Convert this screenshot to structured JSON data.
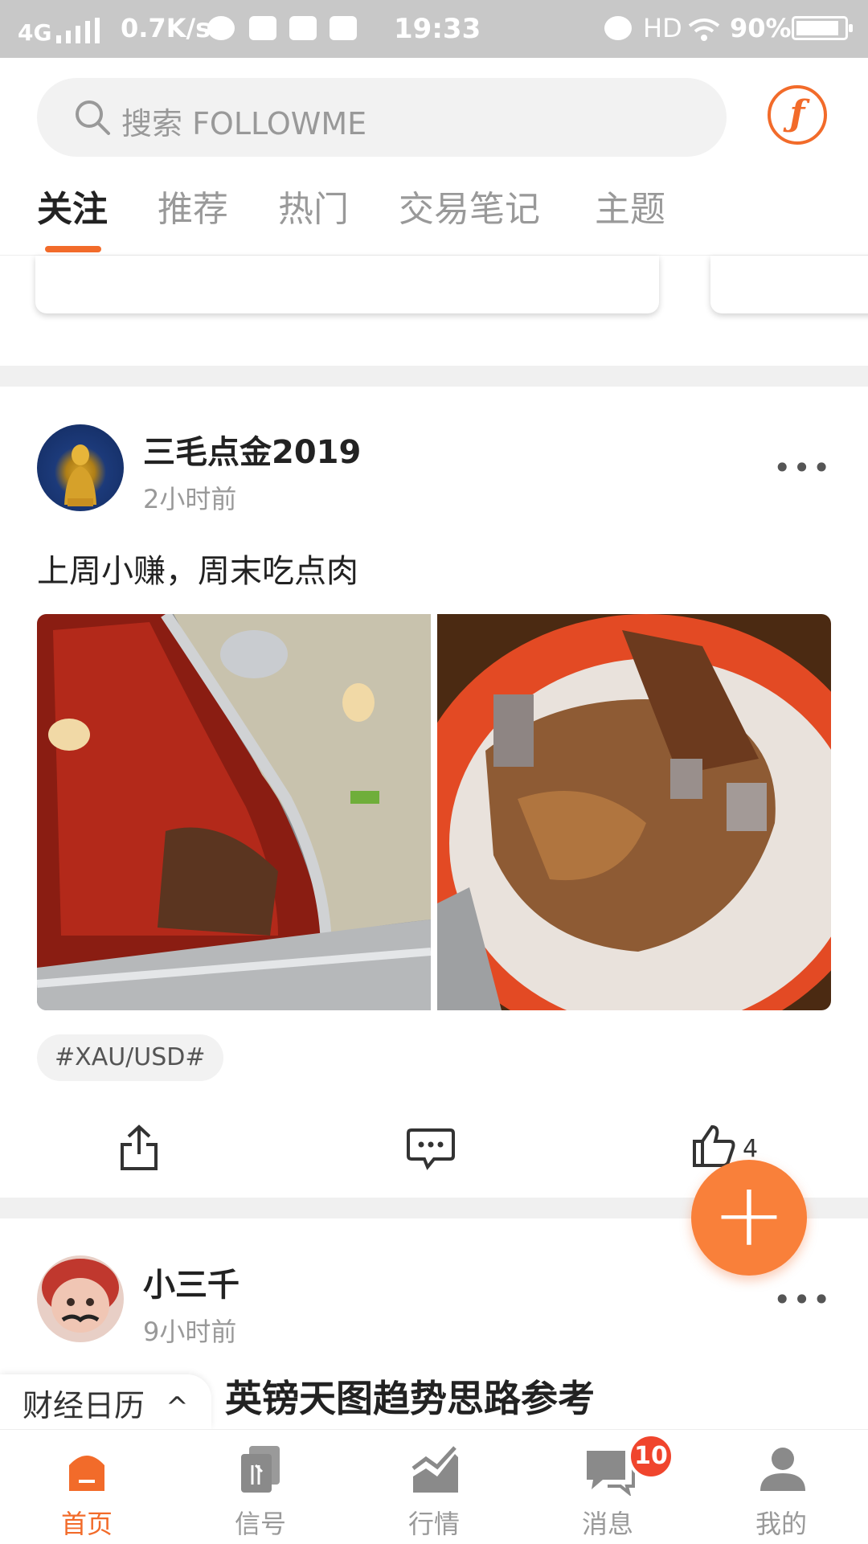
{
  "status_bar": {
    "network": "4G",
    "speed": "0.7K/s",
    "time": "19:33",
    "hd": "HD",
    "battery": "90%"
  },
  "header": {
    "search_placeholder": "搜索 FOLLOWME",
    "logo_glyph": "ƒ",
    "tabs": [
      {
        "label": "关注",
        "active": true
      },
      {
        "label": "推荐",
        "active": false
      },
      {
        "label": "热门",
        "active": false
      },
      {
        "label": "交易笔记",
        "active": false
      },
      {
        "label": "主题",
        "active": false
      }
    ]
  },
  "posts": [
    {
      "author": "三毛点金2019",
      "time": "2小时前",
      "text": "上周小赚，周末吃点肉",
      "tag": "#XAU/USD#",
      "like_count": "4"
    },
    {
      "author": "小三千",
      "time": "9小时前",
      "title": "英镑天图趋势思路参考"
    }
  ],
  "fab_label": "+",
  "calendar": {
    "label": "财经日历",
    "chevron": "^"
  },
  "bottom_nav": [
    {
      "label": "首页",
      "icon": "home-icon",
      "active": true
    },
    {
      "label": "信号",
      "icon": "signal-icon",
      "active": false
    },
    {
      "label": "行情",
      "icon": "market-chart-icon",
      "active": false
    },
    {
      "label": "消息",
      "icon": "message-icon",
      "active": false,
      "badge": "10"
    },
    {
      "label": "我的",
      "icon": "profile-icon",
      "active": false
    }
  ],
  "colors": {
    "accent": "#f26b2a",
    "badge": "#f0452d"
  }
}
